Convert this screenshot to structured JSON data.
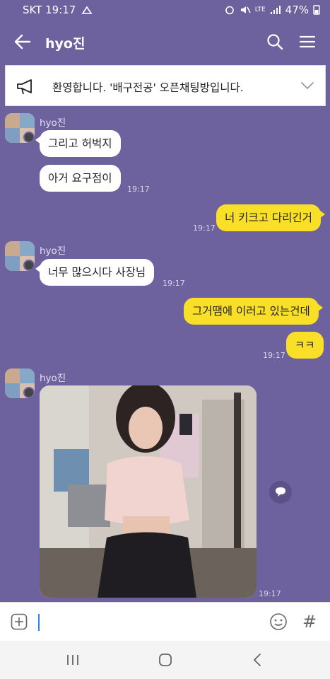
{
  "status": {
    "carrier_time": "SKT 19:17",
    "lte": "LTE",
    "battery": "47%"
  },
  "header": {
    "title": "hyo진"
  },
  "notice": {
    "text": "환영합니다. '배구전공' 오픈채팅방입니다."
  },
  "messages": {
    "sender": "hyo진",
    "m1": "그리고 허벅지",
    "m2": "아거 요구점이",
    "t1": "19:17",
    "m3": "너 키크고 다리긴거",
    "t2": "19:17",
    "m4": "너무 많으시다 사장님",
    "t3": "19:17",
    "m5": "그거땜에 이러고 있는건데",
    "m6": "ㅋㅋ",
    "t4": "19:17",
    "t5": "19:17"
  },
  "input": {
    "hash": "#"
  },
  "icons": {
    "back": "back-arrow-icon",
    "search": "search-icon",
    "menu": "hamburger-menu-icon",
    "notice": "megaphone-icon",
    "expand": "chevron-down-icon",
    "share": "share-bubble-icon",
    "plus": "plus-box-icon",
    "emoji": "emoji-icon"
  },
  "colors": {
    "background": "#6e629e",
    "outgoing": "#f9df28",
    "incoming": "#ffffff"
  }
}
